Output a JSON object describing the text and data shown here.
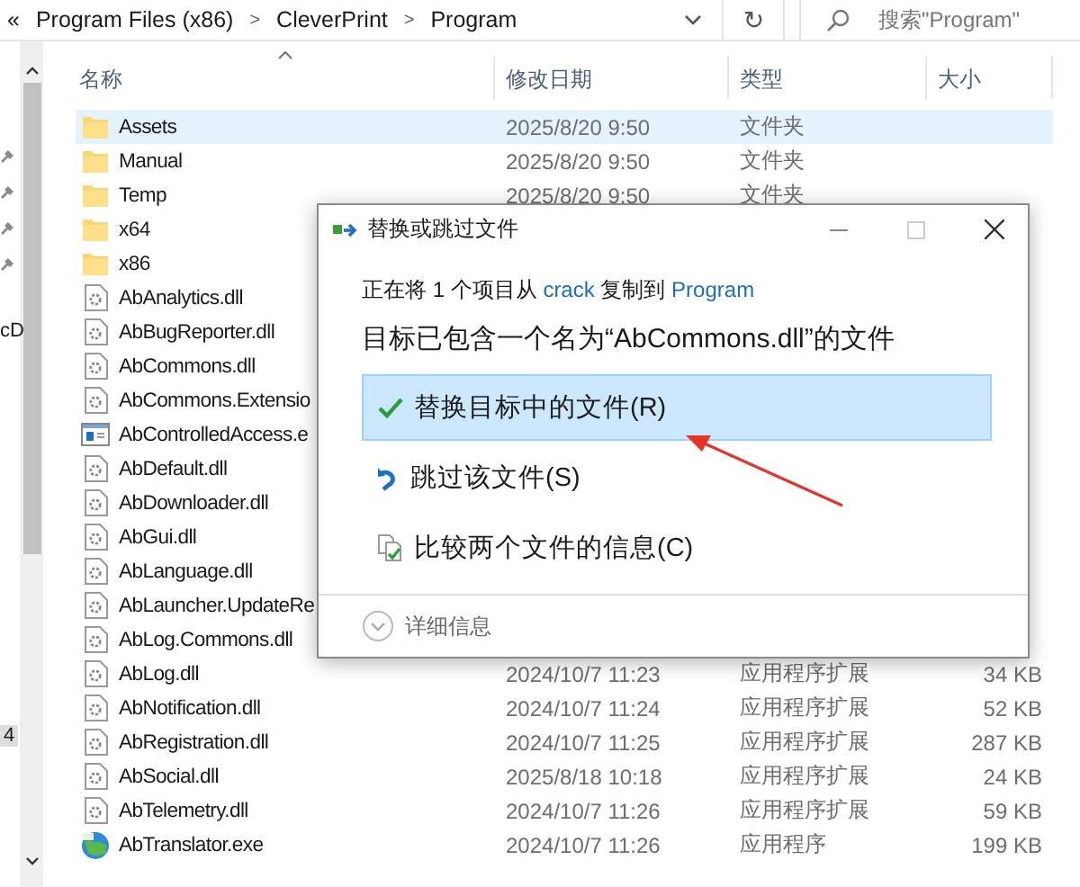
{
  "address_bar": {
    "back_glyph": "«",
    "path": [
      {
        "label": "Program Files (x86)"
      },
      {
        "label": "CleverPrint"
      },
      {
        "label": "Program"
      }
    ],
    "separator": ">",
    "refresh_glyph": "↻",
    "search": {
      "placeholder": "搜索\"Program\""
    }
  },
  "nav_fragments": [
    {
      "text": "cD",
      "selected": false
    },
    {
      "text": "4",
      "selected": true
    }
  ],
  "columns": [
    {
      "label": "名称",
      "sorted": true
    },
    {
      "label": "修改日期",
      "sorted": false
    },
    {
      "label": "类型",
      "sorted": false
    },
    {
      "label": "大小",
      "sorted": false
    }
  ],
  "rows": [
    {
      "name": "Assets",
      "kind": "folder",
      "selected": true,
      "date": "2025/8/20 9:50",
      "type": "文件夹"
    },
    {
      "name": "Manual",
      "kind": "folder",
      "selected": false,
      "date": "2025/8/20 9:50",
      "type": "文件夹"
    },
    {
      "name": "Temp",
      "kind": "folder",
      "selected": false,
      "date": "2025/8/20 9:50",
      "type": "文件夹"
    },
    {
      "name": "x64",
      "kind": "folder",
      "selected": false
    },
    {
      "name": "x86",
      "kind": "folder",
      "selected": false
    },
    {
      "name": "AbAnalytics.dll",
      "kind": "dll",
      "selected": false
    },
    {
      "name": "AbBugReporter.dll",
      "kind": "dll",
      "selected": false
    },
    {
      "name": "AbCommons.dll",
      "kind": "dll",
      "selected": false
    },
    {
      "name": "AbCommons.Extensio",
      "kind": "dll",
      "selected": false
    },
    {
      "name": "AbControlledAccess.e",
      "kind": "app",
      "selected": false
    },
    {
      "name": "AbDefault.dll",
      "kind": "dll",
      "selected": false
    },
    {
      "name": "AbDownloader.dll",
      "kind": "dll",
      "selected": false
    },
    {
      "name": "AbGui.dll",
      "kind": "dll",
      "selected": false
    },
    {
      "name": "AbLanguage.dll",
      "kind": "dll",
      "selected": false
    },
    {
      "name": "AbLauncher.UpdateRe",
      "kind": "dll",
      "selected": false
    },
    {
      "name": "AbLog.Commons.dll",
      "kind": "dll",
      "selected": false
    },
    {
      "name": "AbLog.dll",
      "kind": "dll",
      "selected": false,
      "date": "2024/10/7 11:23",
      "type": "应用程序扩展",
      "size": "34 KB"
    },
    {
      "name": "AbNotification.dll",
      "kind": "dll",
      "selected": false,
      "date": "2024/10/7 11:24",
      "type": "应用程序扩展",
      "size": "52 KB"
    },
    {
      "name": "AbRegistration.dll",
      "kind": "dll",
      "selected": false,
      "date": "2024/10/7 11:25",
      "type": "应用程序扩展",
      "size": "287 KB"
    },
    {
      "name": "AbSocial.dll",
      "kind": "dll",
      "selected": false,
      "date": "2025/8/18 10:18",
      "type": "应用程序扩展",
      "size": "24 KB"
    },
    {
      "name": "AbTelemetry.dll",
      "kind": "dll",
      "selected": false,
      "date": "2024/10/7 11:26",
      "type": "应用程序扩展",
      "size": "59 KB"
    },
    {
      "name": "AbTranslator.exe",
      "kind": "translator",
      "selected": false,
      "date": "2024/10/7 11:26",
      "type": "应用程序",
      "size": "199 KB"
    }
  ],
  "dialog": {
    "title": "替换或跳过文件",
    "copy_line": [
      {
        "text": "正在将 1 个项目从",
        "kind": "plain"
      },
      {
        "text": "crack",
        "kind": "link"
      },
      {
        "text": "复制到",
        "kind": "plain"
      },
      {
        "text": "Program",
        "kind": "link"
      }
    ],
    "message": "目标已包含一个名为“AbCommons.dll”的文件",
    "options": [
      {
        "label": "替换目标中的文件(R)",
        "kind": "replace",
        "selected": true
      },
      {
        "label": "跳过该文件(S)",
        "kind": "skip",
        "selected": false
      },
      {
        "label": "比较两个文件的信息(C)",
        "kind": "compare",
        "selected": false
      }
    ],
    "details": "详细信息"
  }
}
